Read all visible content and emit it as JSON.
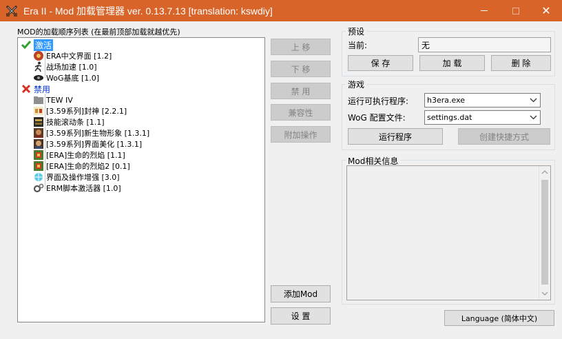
{
  "window": {
    "title": "Era II - Mod 加载管理器 ver. 0.13.7.13 [translation: kswdiy]",
    "accent_color": "#d9642a"
  },
  "mod_list": {
    "caption": "MOD的加载顺序列表 (在最前顶部加载就越优先)",
    "groups": [
      {
        "label": "激活",
        "icon": "check-icon",
        "items": [
          {
            "label": "ERA中文界面 [1.2]",
            "icon": "era-ui-icon"
          },
          {
            "label": "战场加速 [1.0]",
            "icon": "running-man-icon"
          },
          {
            "label": "WoG基底 [1.0]",
            "icon": "wog-eye-icon"
          }
        ]
      },
      {
        "label": "禁用",
        "icon": "cross-icon",
        "items": [
          {
            "label": "TEW IV",
            "icon": "folder-icon"
          },
          {
            "label": "[3.59系列]封神 [2.2.1]",
            "icon": "fengshen-icon"
          },
          {
            "label": "技能滚动条 [1.1]",
            "icon": "scroll-icon"
          },
          {
            "label": "[3.59系列]新生物形象 [1.3.1]",
            "icon": "creature-portrait-icon"
          },
          {
            "label": "[3.59系列]界面美化 [1.3.1]",
            "icon": "creature-portrait-icon"
          },
          {
            "label": "[ERA]生命的烈焰 [1.1]",
            "icon": "flame-tile-icon"
          },
          {
            "label": "[ERA]生命的烈焰2 [0.1]",
            "icon": "flame-tile-icon"
          },
          {
            "label": "界面及操作增强 [3.0]",
            "icon": "globe-icon"
          },
          {
            "label": "ERM脚本激活器 [1.0]",
            "icon": "gears-icon"
          }
        ]
      }
    ]
  },
  "actions": {
    "move_up": "上 移",
    "move_down": "下 移",
    "disable": "禁 用",
    "compat": "兼容性",
    "extra": "附加操作",
    "add_mod": "添加Mod",
    "settings": "设 置"
  },
  "preset": {
    "group_label": "预设",
    "current_label": "当前:",
    "current_value": "无",
    "save": "保 存",
    "load": "加 载",
    "delete": "删 除"
  },
  "game": {
    "group_label": "游戏",
    "exe_label": "运行可执行程序:",
    "exe_value": "h3era.exe",
    "wog_label": "WoG 配置文件:",
    "wog_value": "settings.dat",
    "run": "运行程序",
    "shortcut": "创建快捷方式"
  },
  "info": {
    "group_label": "Mod相关信息"
  },
  "language_button": "Language (简体中文)"
}
